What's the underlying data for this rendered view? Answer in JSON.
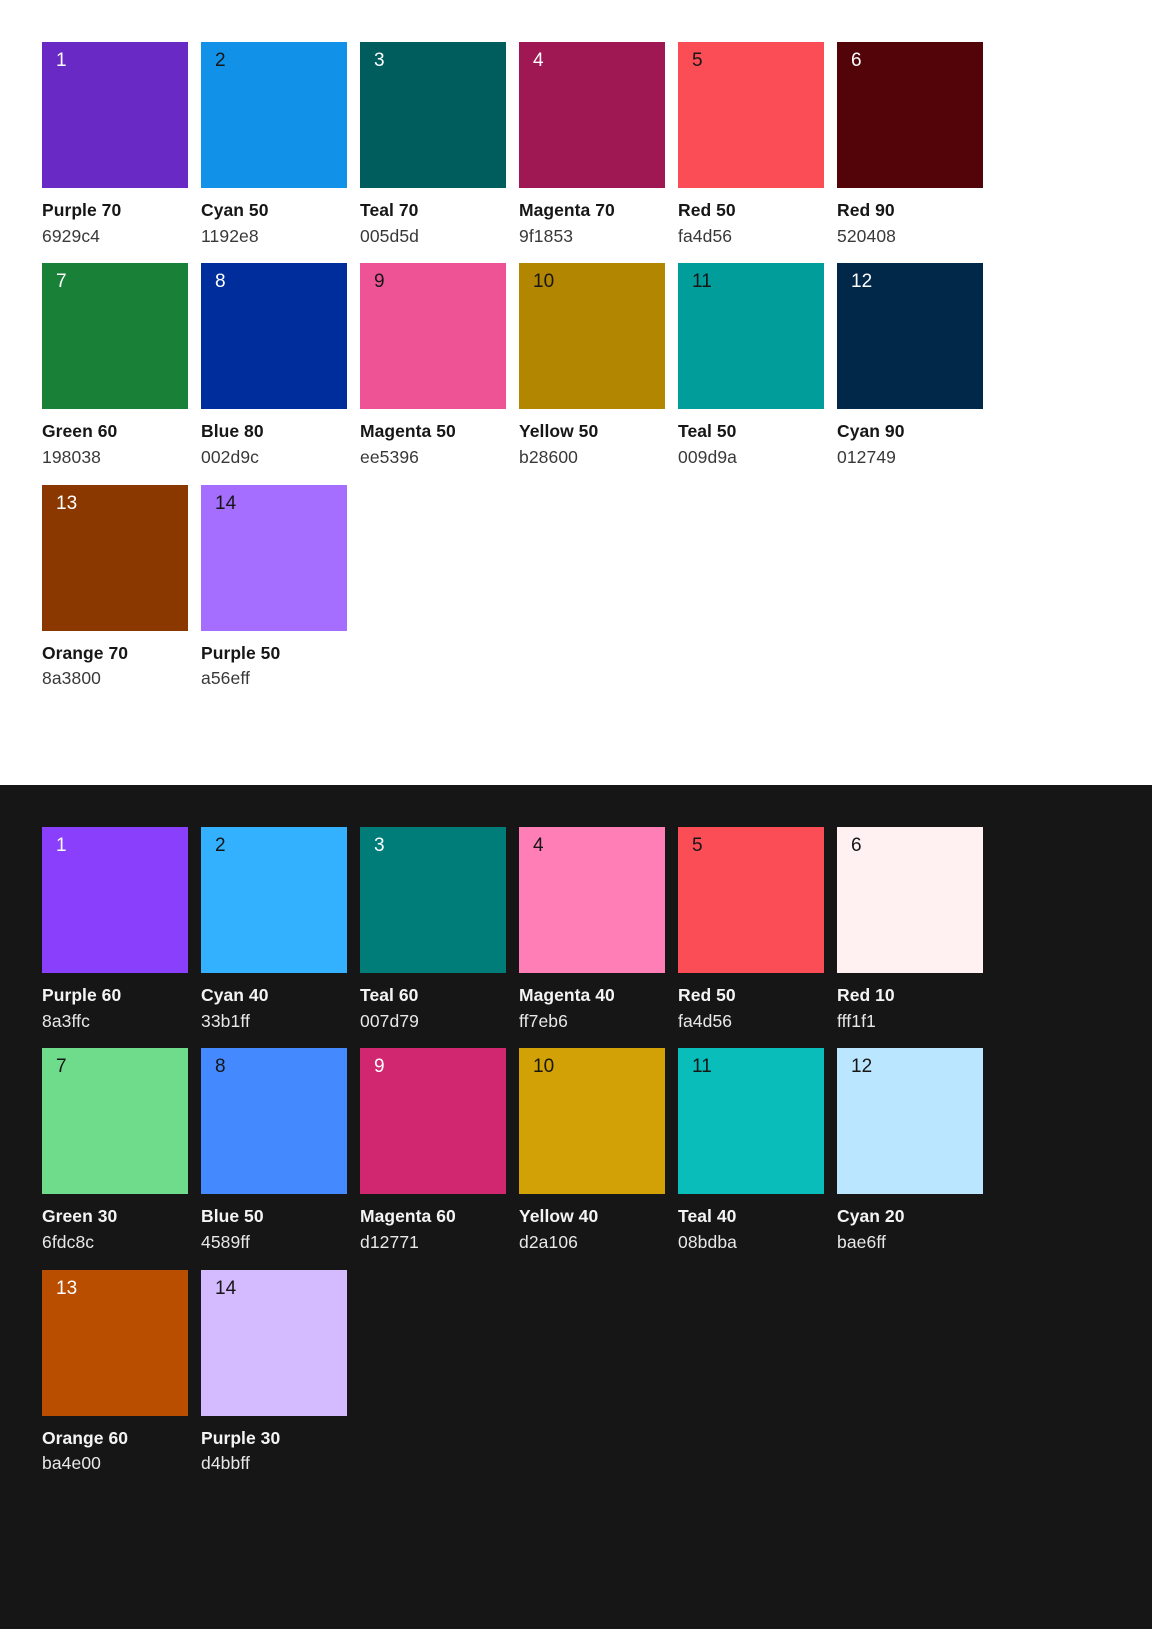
{
  "sections": [
    {
      "id": "light-palette",
      "theme": "light",
      "background": "#ffffff",
      "name_color": "#161616",
      "hex_color": "#393939",
      "swatches": [
        {
          "index": "1",
          "name": "Purple 70",
          "hex": "6929c4",
          "swatch_color": "#6929c4",
          "index_color": "on-dark"
        },
        {
          "index": "2",
          "name": "Cyan 50",
          "hex": "1192e8",
          "swatch_color": "#1192e8",
          "index_color": "on-light"
        },
        {
          "index": "3",
          "name": "Teal 70",
          "hex": "005d5d",
          "swatch_color": "#005d5d",
          "index_color": "on-dark"
        },
        {
          "index": "4",
          "name": "Magenta 70",
          "hex": "9f1853",
          "swatch_color": "#9f1853",
          "index_color": "on-dark"
        },
        {
          "index": "5",
          "name": "Red 50",
          "hex": "fa4d56",
          "swatch_color": "#fa4d56",
          "index_color": "on-light"
        },
        {
          "index": "6",
          "name": "Red 90",
          "hex": "520408",
          "swatch_color": "#520408",
          "index_color": "on-dark"
        },
        {
          "index": "7",
          "name": "Green 60",
          "hex": "198038",
          "swatch_color": "#198038",
          "index_color": "on-dark"
        },
        {
          "index": "8",
          "name": "Blue 80",
          "hex": "002d9c",
          "swatch_color": "#002d9c",
          "index_color": "on-dark"
        },
        {
          "index": "9",
          "name": "Magenta 50",
          "hex": "ee5396",
          "swatch_color": "#ee5396",
          "index_color": "on-light"
        },
        {
          "index": "10",
          "name": "Yellow 50",
          "hex": "b28600",
          "swatch_color": "#b28600",
          "index_color": "on-light"
        },
        {
          "index": "11",
          "name": "Teal 50",
          "hex": "009d9a",
          "swatch_color": "#009d9a",
          "index_color": "on-light"
        },
        {
          "index": "12",
          "name": "Cyan 90",
          "hex": "012749",
          "swatch_color": "#012749",
          "index_color": "on-dark"
        },
        {
          "index": "13",
          "name": "Orange 70",
          "hex": "8a3800",
          "swatch_color": "#8a3800",
          "index_color": "on-dark"
        },
        {
          "index": "14",
          "name": "Purple 50",
          "hex": "a56eff",
          "swatch_color": "#a56eff",
          "index_color": "on-light"
        }
      ]
    },
    {
      "id": "dark-palette",
      "theme": "dark",
      "background": "#161616",
      "name_color": "#f4f4f4",
      "hex_color": "#e8e8e8",
      "swatches": [
        {
          "index": "1",
          "name": "Purple 60",
          "hex": "8a3ffc",
          "swatch_color": "#8a3ffc",
          "index_color": "on-dark"
        },
        {
          "index": "2",
          "name": "Cyan 40",
          "hex": "33b1ff",
          "swatch_color": "#33b1ff",
          "index_color": "on-light"
        },
        {
          "index": "3",
          "name": "Teal 60",
          "hex": "007d79",
          "swatch_color": "#007d79",
          "index_color": "on-dark"
        },
        {
          "index": "4",
          "name": "Magenta 40",
          "hex": "ff7eb6",
          "swatch_color": "#ff7eb6",
          "index_color": "on-light"
        },
        {
          "index": "5",
          "name": "Red 50",
          "hex": "fa4d56",
          "swatch_color": "#fa4d56",
          "index_color": "on-light"
        },
        {
          "index": "6",
          "name": "Red 10",
          "hex": "fff1f1",
          "swatch_color": "#fff1f1",
          "index_color": "on-light"
        },
        {
          "index": "7",
          "name": "Green 30",
          "hex": "6fdc8c",
          "swatch_color": "#6fdc8c",
          "index_color": "on-light"
        },
        {
          "index": "8",
          "name": "Blue 50",
          "hex": "4589ff",
          "swatch_color": "#4589ff",
          "index_color": "on-light"
        },
        {
          "index": "9",
          "name": "Magenta 60",
          "hex": "d12771",
          "swatch_color": "#d12771",
          "index_color": "on-dark"
        },
        {
          "index": "10",
          "name": "Yellow 40",
          "hex": "d2a106",
          "swatch_color": "#d2a106",
          "index_color": "on-light"
        },
        {
          "index": "11",
          "name": "Teal 40",
          "hex": "08bdba",
          "swatch_color": "#08bdba",
          "index_color": "on-light"
        },
        {
          "index": "12",
          "name": "Cyan 20",
          "hex": "bae6ff",
          "swatch_color": "#bae6ff",
          "index_color": "on-light"
        },
        {
          "index": "13",
          "name": "Orange 60",
          "hex": "ba4e00",
          "swatch_color": "#ba4e00",
          "index_color": "on-dark"
        },
        {
          "index": "14",
          "name": "Purple 30",
          "hex": "d4bbff",
          "swatch_color": "#d4bbff",
          "index_color": "on-light"
        }
      ]
    }
  ]
}
